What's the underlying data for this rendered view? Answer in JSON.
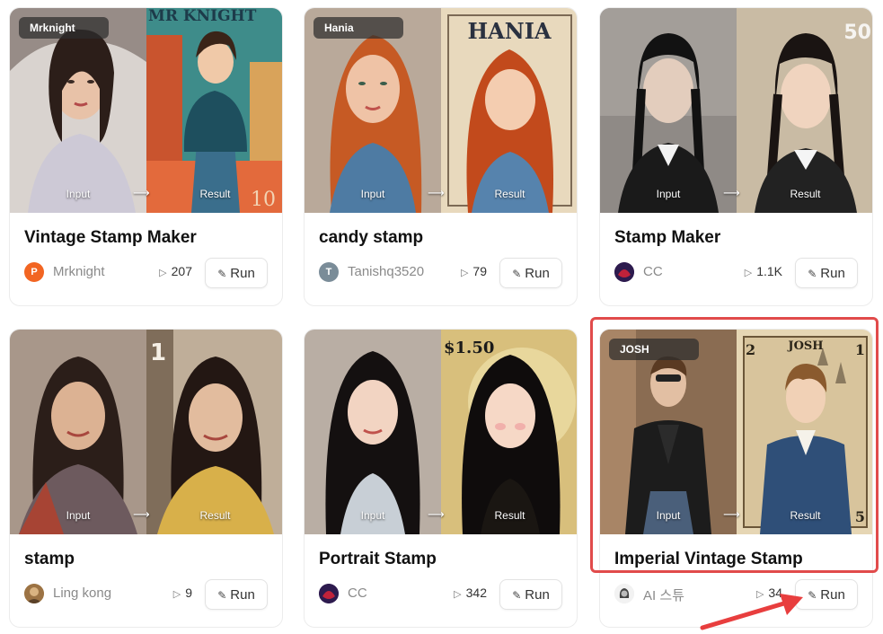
{
  "cards": [
    {
      "tag": "Mrknight",
      "title": "Vintage Stamp Maker",
      "author": "Mrknight",
      "avatar_text": "P",
      "runs": "207",
      "input_label": "Input",
      "result_label": "Result",
      "run_label": "Run"
    },
    {
      "tag": "Hania",
      "title": "candy stamp",
      "author": "Tanishq3520",
      "avatar_text": "T",
      "runs": "79",
      "input_label": "Input",
      "result_label": "Result",
      "run_label": "Run"
    },
    {
      "tag": "",
      "title": "Stamp Maker",
      "author": "CC",
      "avatar_text": "",
      "runs": "1.1K",
      "input_label": "Input",
      "result_label": "Result",
      "run_label": "Run"
    },
    {
      "tag": "",
      "title": "stamp",
      "author": "Ling kong",
      "avatar_text": "",
      "runs": "9",
      "input_label": "Input",
      "result_label": "Result",
      "run_label": "Run"
    },
    {
      "tag": "",
      "title": "Portrait Stamp",
      "author": "CC",
      "avatar_text": "",
      "runs": "342",
      "input_label": "Input",
      "result_label": "Result",
      "run_label": "Run"
    },
    {
      "tag": "JOSH",
      "title": "Imperial Vintage Stamp",
      "author": "AI 스튜",
      "avatar_text": "",
      "runs": "34",
      "input_label": "Input",
      "result_label": "Result",
      "run_label": "Run"
    }
  ],
  "stamp_text": {
    "card1": "MR KNIGHT",
    "card1_number": "10",
    "card2": "HANIA",
    "card3_number": "50",
    "card4_number": "1",
    "card5_price": "$1.50",
    "card6": "JOSH",
    "card6_corner_left": "2",
    "card6_corner_right": "1",
    "card6_corner_bottom": "5"
  },
  "colors": {
    "highlight": "#e14b4b",
    "avatar_mrknight": "#f26522",
    "avatar_tanishq": "#7a8c98"
  },
  "icons": {
    "play": "play-icon",
    "run": "magic-wand-icon",
    "arrow": "right-arrow-icon"
  }
}
